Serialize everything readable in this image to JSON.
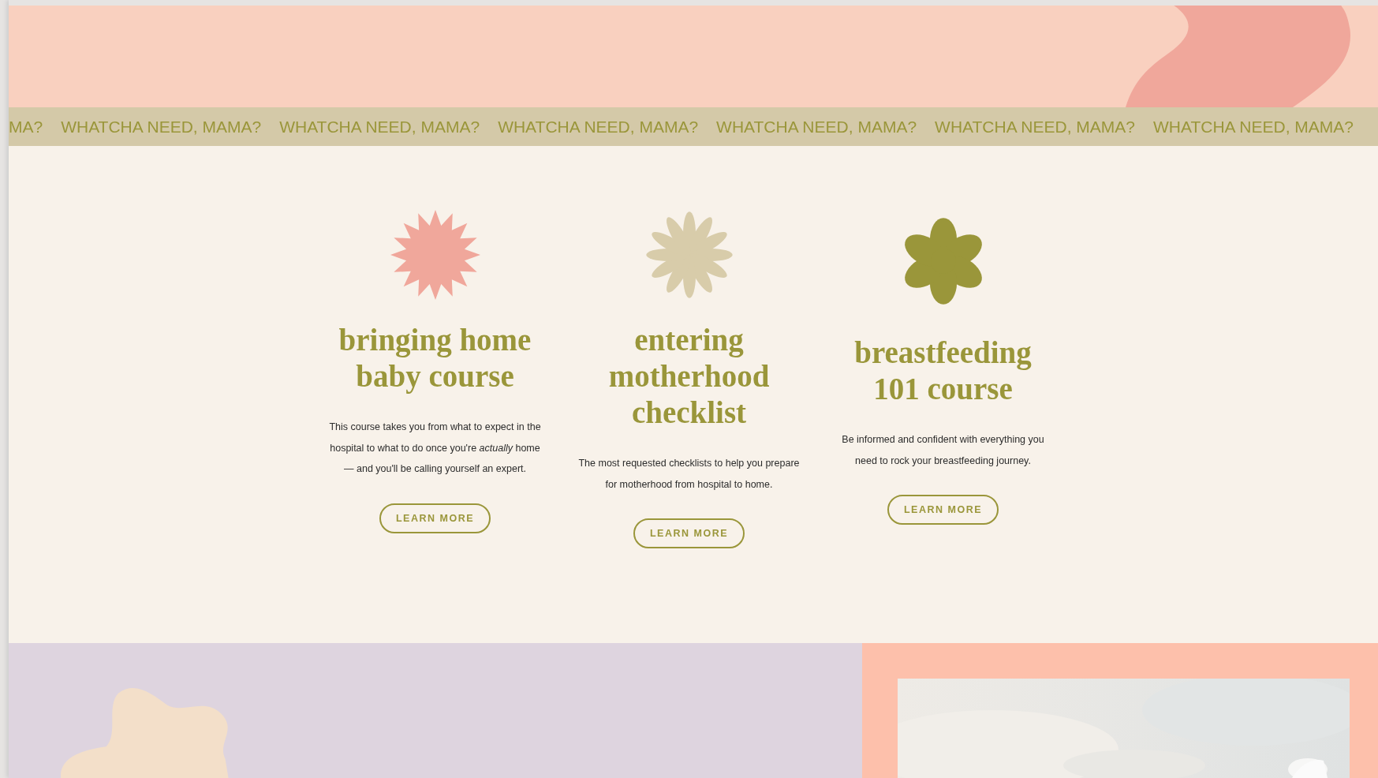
{
  "marquee": [
    "MA?",
    "WHATCHA NEED, MAMA?",
    "WHATCHA NEED, MAMA?",
    "WHATCHA NEED, MAMA?",
    "WHATCHA NEED, MAMA?",
    "WHATCHA NEED, MAMA?",
    "WHATCHA NEED, MAMA?"
  ],
  "cards": [
    {
      "kind": "starburst",
      "title": "bringing home baby course",
      "body": "This course takes you from what to expect in the hospital to what to do once you're *actually* home — and you'll be calling yourself an expert.",
      "button": "LEARN MORE"
    },
    {
      "kind": "daisy",
      "title": "entering motherhood checklist",
      "body": "The most requested checklists to help you prepare for motherhood from hospital to home.",
      "button": "LEARN MORE"
    },
    {
      "kind": "flower",
      "title": "breastfeeding 101 course",
      "body": "Be informed and confident with everything you need to rock your breastfeeding journey.",
      "button": "LEARN MORE"
    }
  ]
}
